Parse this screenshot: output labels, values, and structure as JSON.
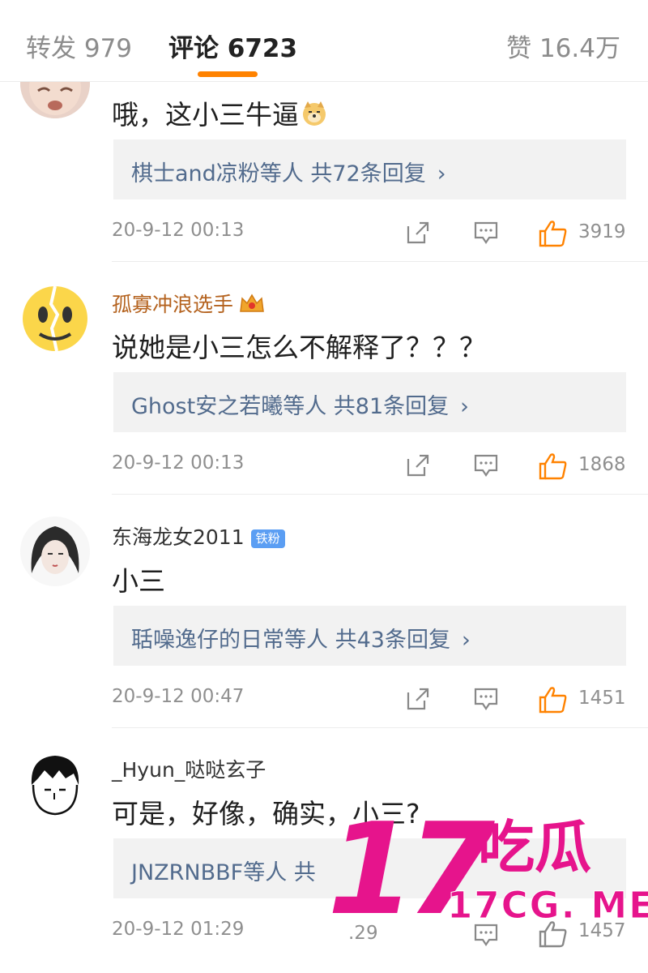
{
  "tabs": {
    "repost": "转发 979",
    "comments": "评论 6723",
    "likes": "赞 16.4万"
  },
  "comments": [
    {
      "username": "",
      "text": "哦，这小三牛逼",
      "emoji": "doge-emoji",
      "replies": "棋士and凉粉等人 共72条回复",
      "timestamp": "20-9-12 00:13",
      "likes": "3919"
    },
    {
      "username": "孤寡冲浪选手",
      "badge": "crown-badge-icon",
      "text": "说她是小三怎么不解释了？？？",
      "replies": "Ghost安之若曦等人 共81条回复",
      "timestamp": "20-9-12 00:13",
      "likes": "1868"
    },
    {
      "username": "东海龙女2011",
      "fan_badge": "铁粉",
      "text": "小三",
      "replies": "聒噪逸仔的日常等人 共43条回复",
      "timestamp": "20-9-12 00:47",
      "likes": "1451"
    },
    {
      "username": "_Hyun_哒哒玄子",
      "text": "可是，好像，确实，小三?",
      "replies": "JNZRNBBF等人 共",
      "timestamp": "20-9-12 01:29",
      "likes": "1457",
      "overlap_count": ".29"
    }
  ],
  "watermark": {
    "number": "17",
    "chinese": "吃瓜",
    "site": "17CG. ME",
    "color": "#e6148c"
  },
  "colors": {
    "accent": "#ff8200",
    "reply_link": "#526b8d",
    "username": "#b4621e",
    "like_icon": "#ff8200",
    "fan_badge": "#5b9ef3"
  },
  "icons": [
    "share-icon",
    "reply-icon",
    "like-icon",
    "chevron-right-icon"
  ]
}
